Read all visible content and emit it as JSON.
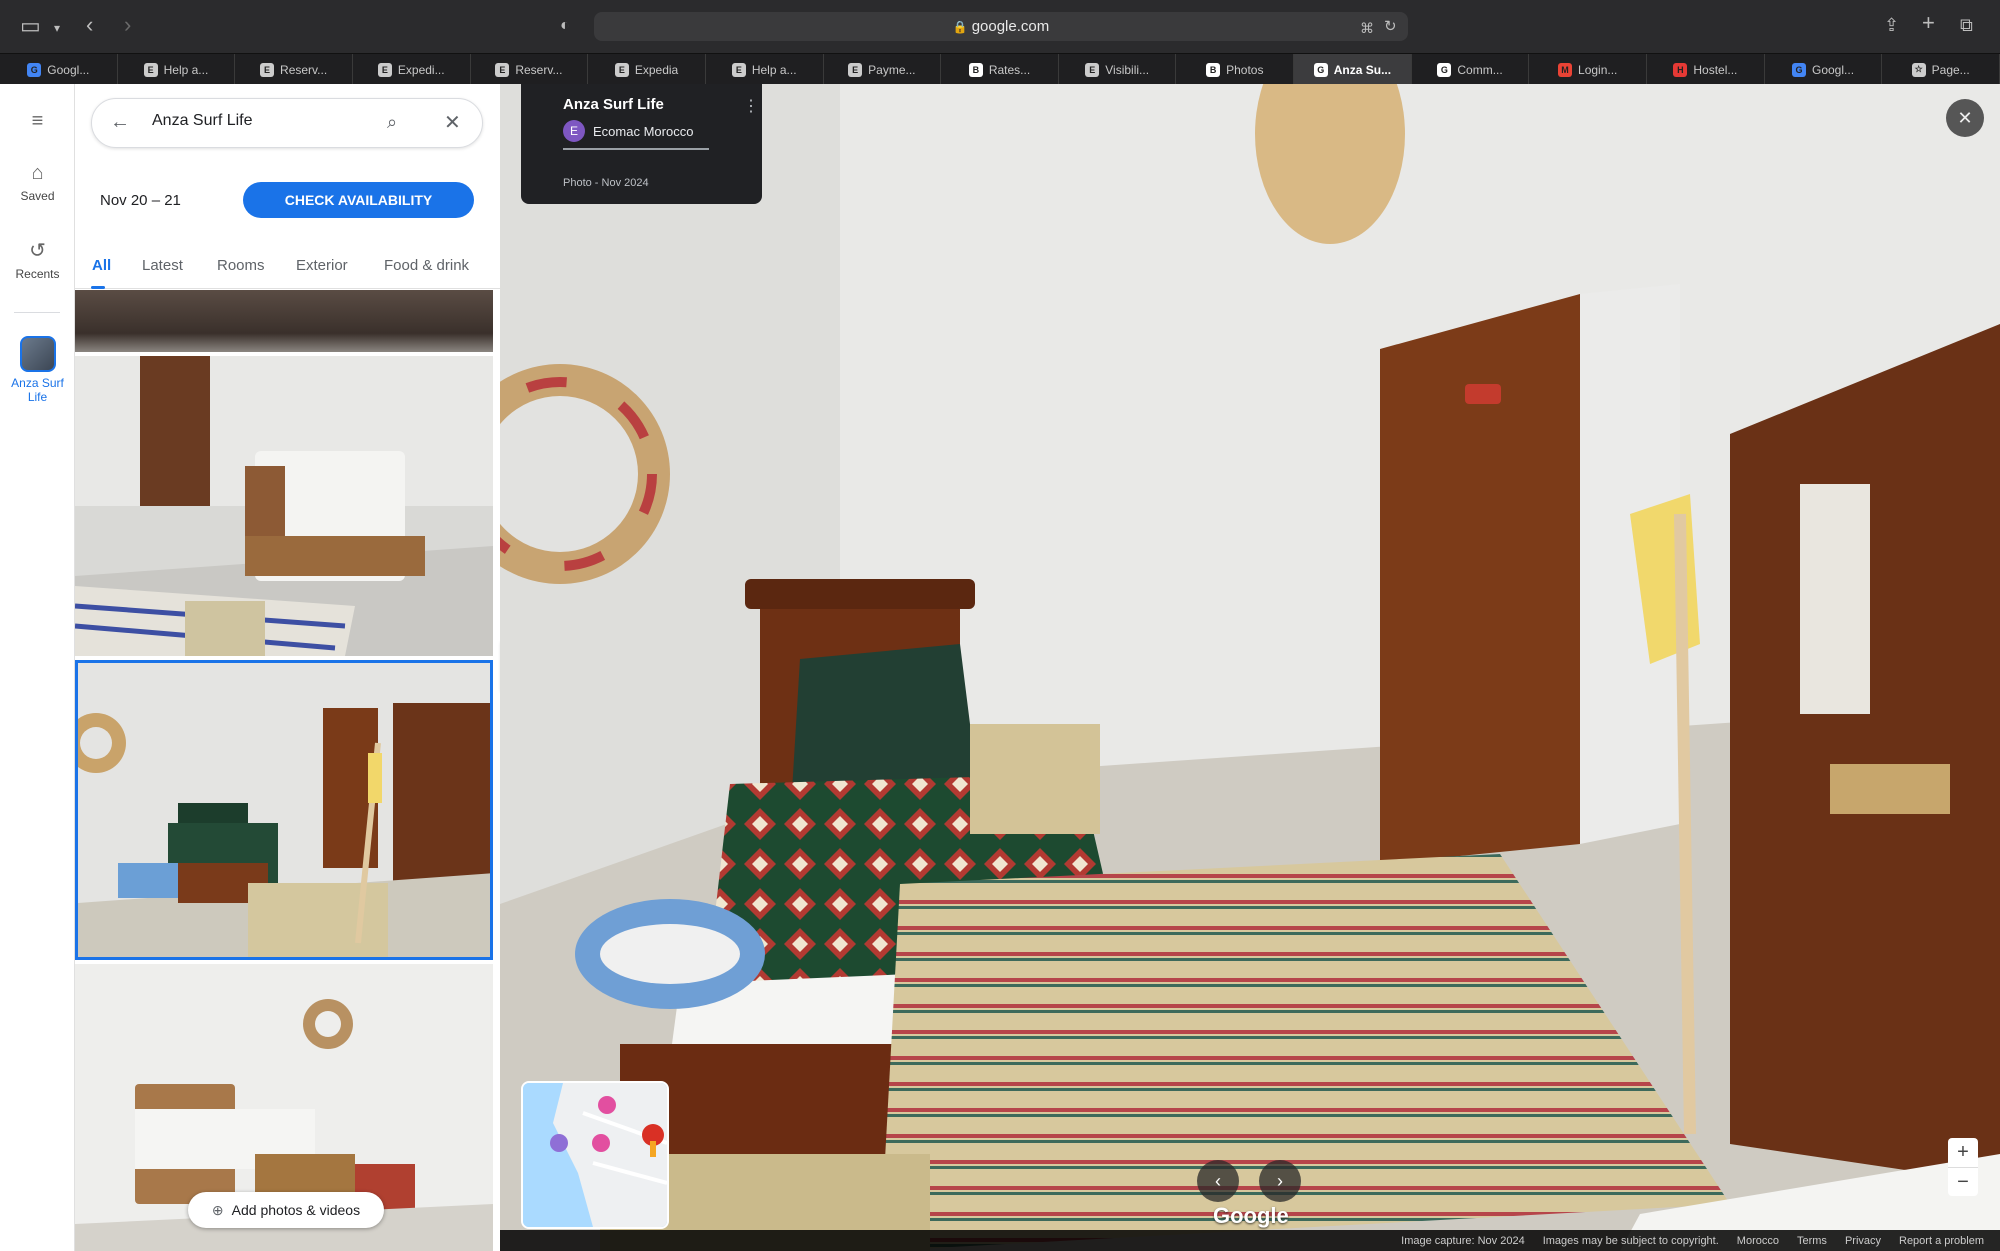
{
  "browser": {
    "url": "google.com",
    "tabs": [
      {
        "label": "Googl...",
        "favicon": "G",
        "color": "#4285f4"
      },
      {
        "label": "Help a...",
        "favicon": "E",
        "color": "#cccccc"
      },
      {
        "label": "Reserv...",
        "favicon": "E",
        "color": "#cccccc"
      },
      {
        "label": "Expedi...",
        "favicon": "E",
        "color": "#cccccc"
      },
      {
        "label": "Reserv...",
        "favicon": "E",
        "color": "#cccccc"
      },
      {
        "label": "Expedia",
        "favicon": "E",
        "color": "#cccccc"
      },
      {
        "label": "Help a...",
        "favicon": "E",
        "color": "#cccccc"
      },
      {
        "label": "Payme...",
        "favicon": "E",
        "color": "#cccccc"
      },
      {
        "label": "Rates...",
        "favicon": "B",
        "color": "#ffffff"
      },
      {
        "label": "Visibili...",
        "favicon": "E",
        "color": "#cccccc"
      },
      {
        "label": "Photos",
        "favicon": "B",
        "color": "#ffffff"
      },
      {
        "label": "Anza Su...",
        "favicon": "G",
        "color": "#ffffff",
        "active": true
      },
      {
        "label": "Comm...",
        "favicon": "G",
        "color": "#ffffff"
      },
      {
        "label": "Login...",
        "favicon": "M",
        "color": "#ea4335"
      },
      {
        "label": "Hostel...",
        "favicon": "H",
        "color": "#e53935"
      },
      {
        "label": "Googl...",
        "favicon": "G",
        "color": "#4285f4"
      },
      {
        "label": "Page...",
        "favicon": "☆",
        "color": "#cccccc"
      }
    ]
  },
  "rail": {
    "menu_icon": "hamburger-icon",
    "saved_label": "Saved",
    "recents_label": "Recents",
    "place_label": "Anza Surf Life"
  },
  "panel": {
    "search_value": "Anza Surf Life",
    "dates": "Nov 20 – 21",
    "check_button": "CHECK AVAILABILITY",
    "tabs": [
      "All",
      "Latest",
      "Rooms",
      "Exterior",
      "Food & drink"
    ],
    "add_photos_label": "Add photos & videos"
  },
  "viewer": {
    "place_name": "Anza Surf Life",
    "author_initial": "E",
    "author_name": "Ecomac Morocco",
    "photo_meta": "Photo - Nov 2024",
    "logo_text": "Google",
    "footer": {
      "capture": "Image capture: Nov 2024",
      "copyright": "Images may be subject to copyright.",
      "country": "Morocco",
      "terms": "Terms",
      "privacy": "Privacy",
      "report": "Report a problem"
    }
  },
  "colors": {
    "accent": "#1a73e8",
    "author_avatar": "#7e57c2"
  }
}
